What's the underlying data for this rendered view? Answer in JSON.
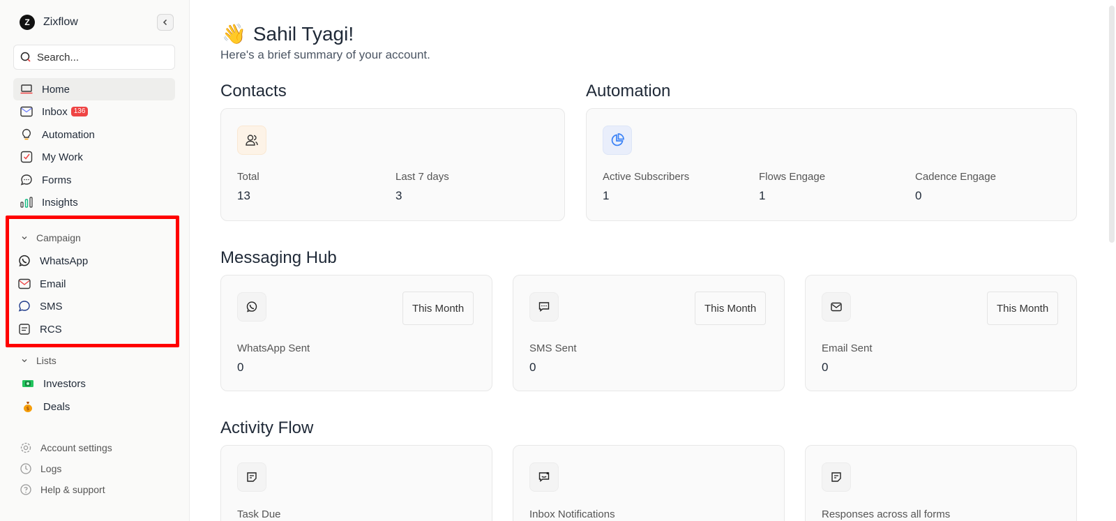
{
  "app": {
    "name": "Zixflow"
  },
  "search": {
    "placeholder": "Search..."
  },
  "nav": {
    "home": "Home",
    "inbox": "Inbox",
    "inbox_badge": "136",
    "automation": "Automation",
    "my_work": "My Work",
    "forms": "Forms",
    "insights": "Insights"
  },
  "campaign": {
    "heading": "Campaign",
    "items": [
      "WhatsApp",
      "Email",
      "SMS",
      "RCS"
    ]
  },
  "lists": {
    "heading": "Lists",
    "items": [
      "Investors",
      "Deals"
    ]
  },
  "bottom": {
    "account_settings": "Account settings",
    "logs": "Logs",
    "help": "Help & support"
  },
  "greeting": {
    "emoji": "👋",
    "name": "Sahil Tyagi!",
    "subtitle": "Here's a brief summary of your account."
  },
  "contacts": {
    "title": "Contacts",
    "total_label": "Total",
    "total_value": "13",
    "last7_label": "Last 7 days",
    "last7_value": "3"
  },
  "automation": {
    "title": "Automation",
    "active_label": "Active Subscribers",
    "active_value": "1",
    "flows_label": "Flows Engage",
    "flows_value": "1",
    "cadence_label": "Cadence Engage",
    "cadence_value": "0"
  },
  "messaging": {
    "title": "Messaging Hub",
    "period": "This Month",
    "whatsapp_label": "WhatsApp Sent",
    "whatsapp_value": "0",
    "sms_label": "SMS Sent",
    "sms_value": "0",
    "email_label": "Email Sent",
    "email_value": "0"
  },
  "activity": {
    "title": "Activity Flow",
    "task_label": "Task Due",
    "inbox_label": "Inbox Notifications",
    "forms_label": "Responses across all forms"
  },
  "colors": {
    "highlight": "#ff0000",
    "badge": "#ef4444",
    "accent_blue": "#3b82f6"
  }
}
